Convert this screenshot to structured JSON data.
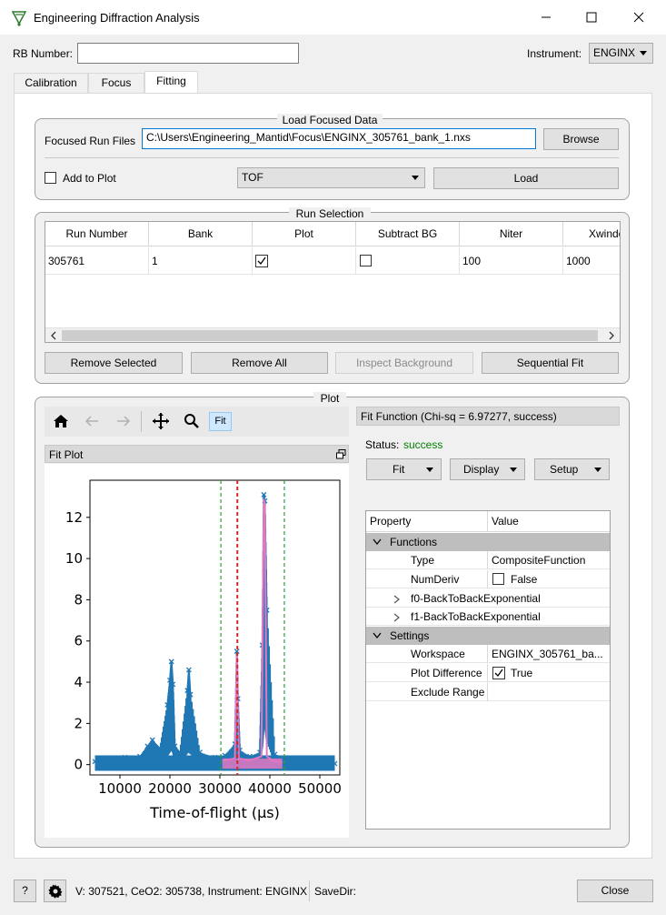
{
  "window": {
    "title": "Engineering Diffraction Analysis",
    "icon": "mantid-app-icon"
  },
  "rb": {
    "label": "RB Number:",
    "value": ""
  },
  "instrument": {
    "label": "Instrument:",
    "value": "ENGINX"
  },
  "tabs": [
    {
      "label": "Calibration",
      "active": false
    },
    {
      "label": "Focus",
      "active": false
    },
    {
      "label": "Fitting",
      "active": true
    }
  ],
  "load_focused": {
    "title": "Load Focused Data",
    "files_label": "Focused Run Files",
    "files_value": "C:\\Users\\Engineering_Mantid\\Focus\\ENGINX_305761_bank_1.nxs",
    "browse": "Browse",
    "add_to_plot": "Add to Plot",
    "unit_value": "TOF",
    "load": "Load"
  },
  "run_selection": {
    "title": "Run Selection",
    "columns": [
      "Run Number",
      "Bank",
      "Plot",
      "Subtract BG",
      "Niter",
      "Xwindow"
    ],
    "rows": [
      {
        "run_number": "305761",
        "bank": "1",
        "plot": true,
        "subtract_bg": false,
        "niter": "100",
        "xwindow": "1000"
      }
    ],
    "buttons": {
      "remove_selected": "Remove Selected",
      "remove_all": "Remove All",
      "inspect_background": "Inspect Background",
      "sequential_fit": "Sequential Fit"
    }
  },
  "plot_group": {
    "title": "Plot",
    "toolbar": {
      "fit_label": "Fit"
    },
    "fit_plot_title": "Fit Plot"
  },
  "fit_panel": {
    "header": "Fit Function (Chi-sq = 6.97277, success)",
    "status_label": "Status:",
    "status_value": "success",
    "status_color": "#008000",
    "menus": {
      "fit": "Fit",
      "display": "Display",
      "setup": "Setup"
    },
    "property_header": "Property",
    "value_header": "Value",
    "functions_label": "Functions",
    "settings_label": "Settings",
    "type_label": "Type",
    "type_value": "CompositeFunction",
    "numderiv_label": "NumDeriv",
    "numderiv_value": "False",
    "f0_label": "f0-BackToBackExponential",
    "f1_label": "f1-BackToBackExponential",
    "workspace_label": "Workspace",
    "workspace_value": "ENGINX_305761_ba...",
    "plot_diff_label": "Plot Difference",
    "plot_diff_value": "True",
    "exclude_label": "Exclude Range",
    "exclude_value": ""
  },
  "statusbar": {
    "help": "?",
    "info": "V: 307521, CeO2: 305738, Instrument: ENGINX",
    "savedir": "SaveDir:",
    "close": "Close"
  },
  "chart_data": {
    "type": "scatter",
    "xlabel": "Time-of-flight (μs)",
    "ylabel": "",
    "title": "",
    "xlim": [
      4000,
      54000
    ],
    "ylim": [
      -0.5,
      13.8
    ],
    "xticks": [
      "10000",
      "20000",
      "30000",
      "40000",
      "50000"
    ],
    "yticks": [
      "0",
      "2",
      "4",
      "6",
      "8",
      "10",
      "12"
    ],
    "series": [
      {
        "kind": "data",
        "color": "#1f77b4",
        "marker": "x",
        "x": [
          5000,
          8000,
          11000,
          14000,
          15500,
          16500,
          18000,
          19500,
          20000,
          20300,
          20600,
          21000,
          22000,
          23500,
          23800,
          24100,
          26000,
          29000,
          31000,
          33000,
          33400,
          33600,
          34000,
          36000,
          38000,
          38500,
          38800,
          39000,
          39400,
          41000,
          44000,
          47000,
          50000,
          53000
        ],
        "y": [
          0.15,
          0.25,
          0.35,
          0.4,
          0.9,
          1.2,
          0.8,
          2.9,
          4.1,
          5.0,
          3.9,
          0.9,
          0.6,
          3.6,
          4.6,
          3.4,
          0.6,
          0.35,
          0.45,
          1.0,
          5.5,
          3.2,
          0.7,
          0.4,
          0.6,
          5.8,
          13.1,
          12.8,
          7.5,
          0.5,
          0.3,
          0.15,
          0.1,
          0.05
        ]
      },
      {
        "kind": "fit",
        "color": "#e377c2",
        "x": [
          30500,
          33000,
          33400,
          33800,
          36000,
          38300,
          38800,
          39000,
          39400,
          40500,
          42500
        ],
        "y": [
          0.2,
          0.3,
          5.3,
          0.3,
          0.2,
          0.4,
          12.9,
          12.5,
          0.4,
          0.2,
          0.1
        ]
      }
    ],
    "vlines": [
      {
        "x": 30200,
        "color": "#2ca02c",
        "style": "dashed"
      },
      {
        "x": 33500,
        "color": "#d62728",
        "style": "dashed"
      },
      {
        "x": 42900,
        "color": "#2ca02c",
        "style": "dashed"
      }
    ],
    "grid": false,
    "legend": "none"
  }
}
